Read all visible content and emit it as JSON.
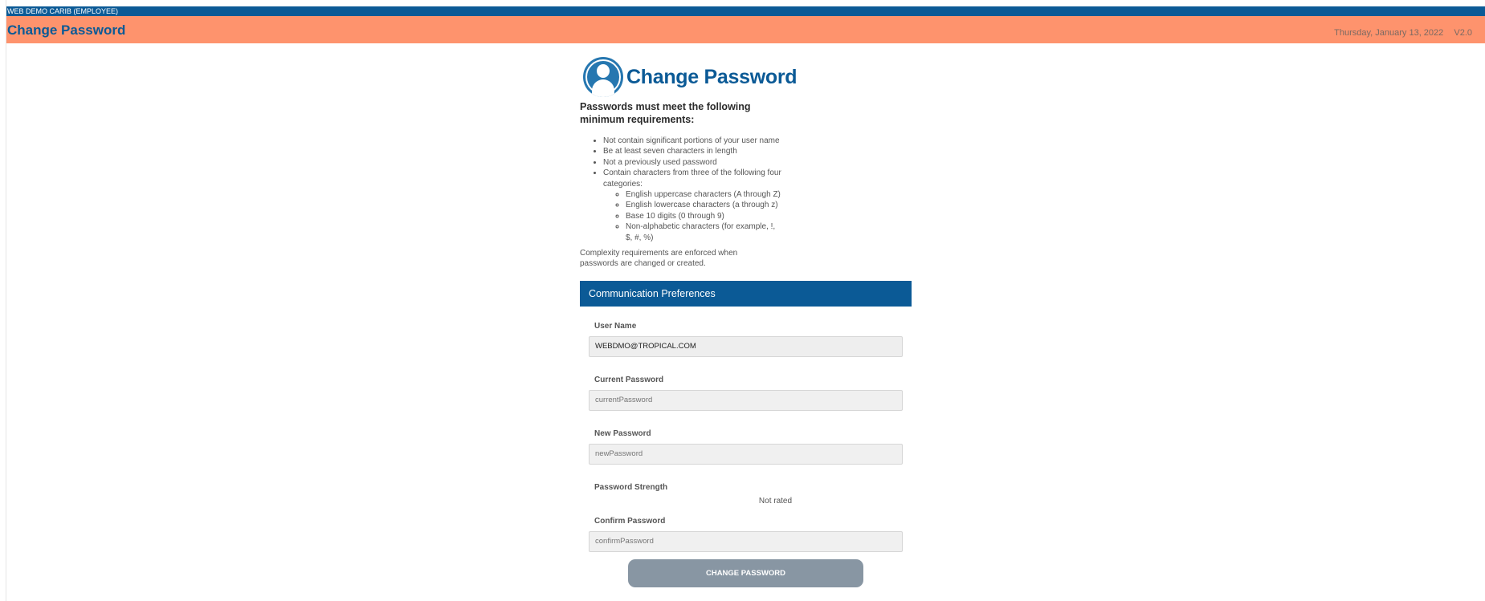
{
  "header": {
    "user_info": "WEB DEMO CARIB  (EMPLOYEE)",
    "page_title": "Change Password",
    "date": "Thursday, January 13, 2022",
    "version": "V2.0",
    "colors": {
      "user_bar": "#0b5a96",
      "title_bar": "#fe936d",
      "title_text": "#0b5a96"
    }
  },
  "main": {
    "title": "Change Password",
    "avatar_icon": "user-circle-icon",
    "requirements_heading": "Passwords must meet the following minimum requirements:",
    "requirements": [
      "Not contain significant portions of your user name",
      "Be at least seven characters in length",
      "Not a previously used password",
      "Contain characters from three of the following four categories:"
    ],
    "categories": [
      "English uppercase characters (A through Z)",
      "English lowercase characters (a through z)",
      "Base 10 digits (0 through 9)",
      "Non-alphabetic characters (for example, !, $, #, %)"
    ],
    "complexity_note": "Complexity requirements are enforced when passwords are changed or created."
  },
  "form": {
    "section_title": "Communication Preferences",
    "username": {
      "label": "User Name",
      "value": "WEBDMO@TROPICAL.COM"
    },
    "current_password": {
      "label": "Current Password",
      "placeholder": "currentPassword"
    },
    "new_password": {
      "label": "New Password",
      "placeholder": "newPassword"
    },
    "strength": {
      "label": "Password Strength",
      "value": "Not rated"
    },
    "confirm_password": {
      "label": "Confirm Password",
      "placeholder": "confirmPassword"
    },
    "submit_label": "CHANGE PASSWORD"
  }
}
